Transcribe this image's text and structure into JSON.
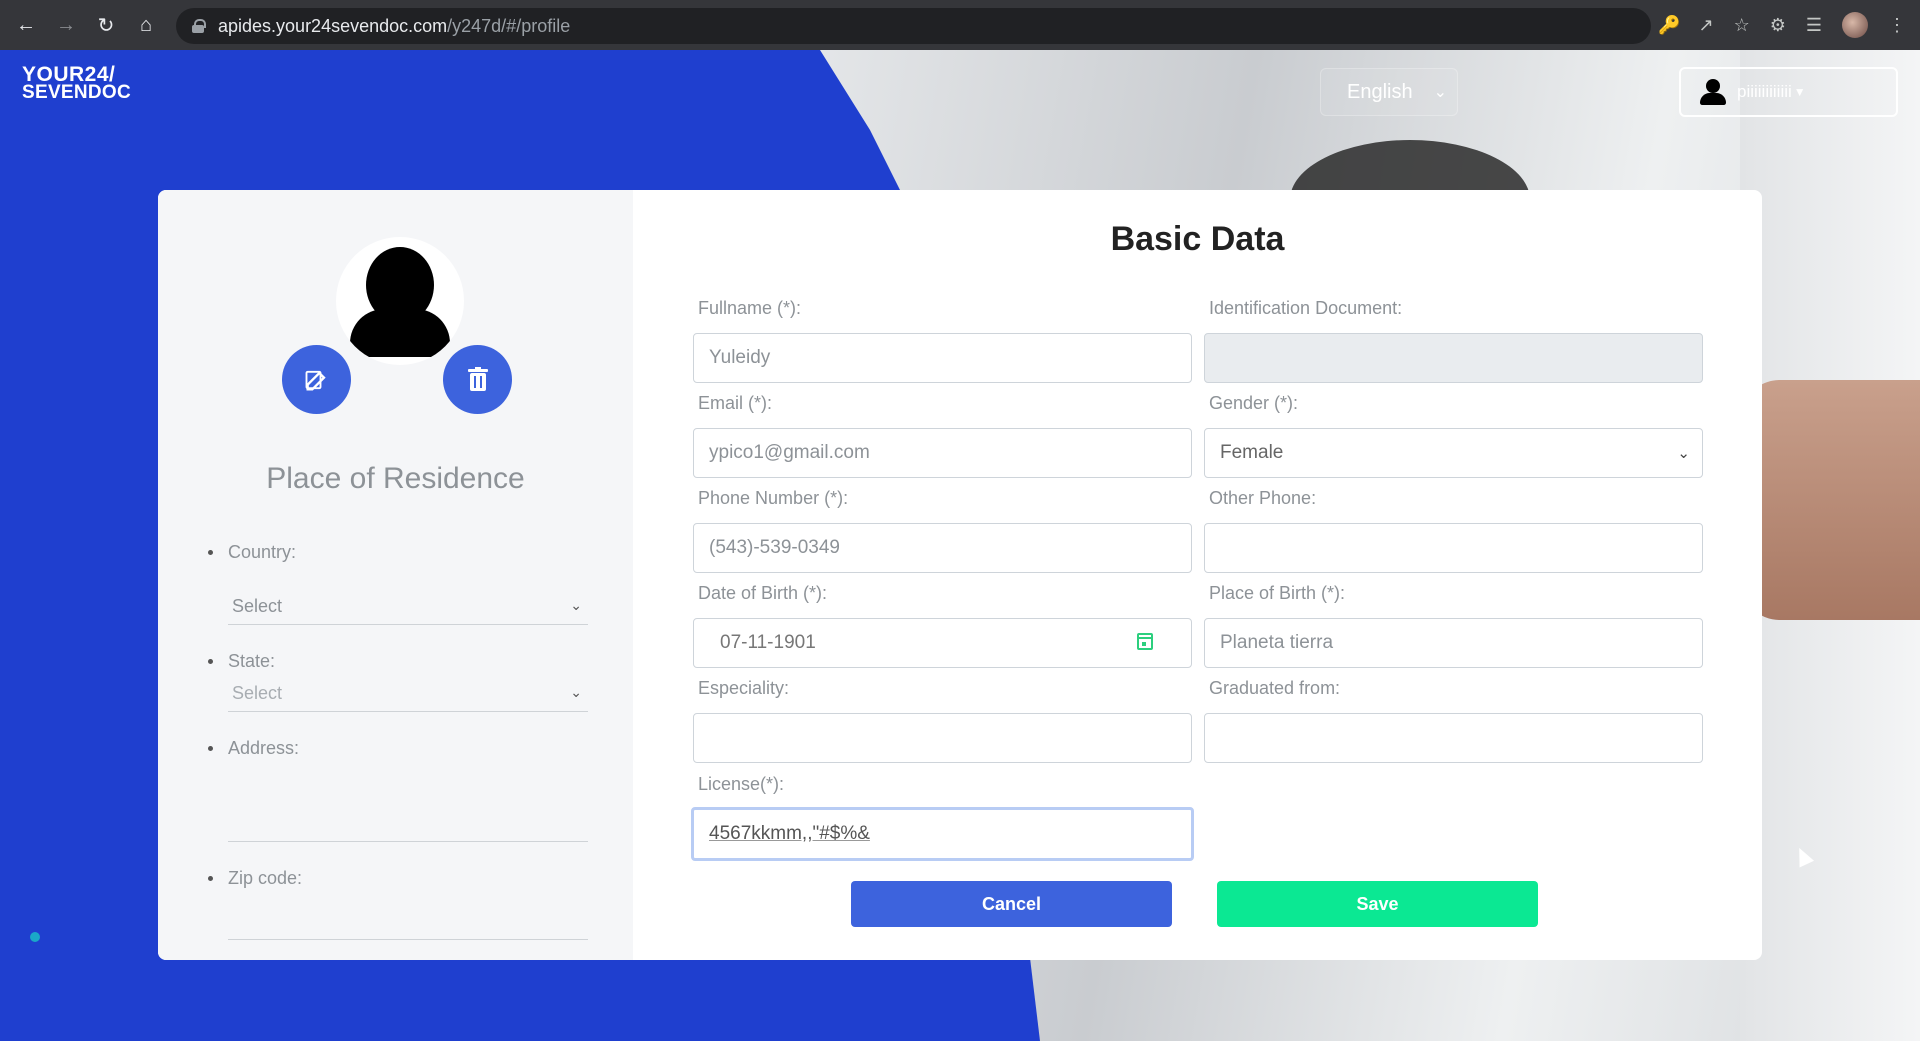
{
  "browser": {
    "url_host": "apides.your24sevendoc.com",
    "url_path": "/y247d/#/profile"
  },
  "header": {
    "logo_line1": "YOUR24/",
    "logo_line2": "SEVENDOC",
    "language": "English",
    "username": "piiiiiiiiiiii"
  },
  "sidebar": {
    "residence_title": "Place of Residence",
    "country_label": "Country:",
    "country_value": "Select",
    "state_label": "State:",
    "state_value": "Select",
    "address_label": "Address:",
    "zip_label": "Zip code:"
  },
  "form": {
    "title": "Basic Data",
    "fullname_label": "Fullname (*):",
    "fullname_value": "Yuleidy",
    "id_doc_label": "Identification Document:",
    "id_doc_value": "",
    "email_label": "Email (*):",
    "email_value": "ypico1@gmail.com",
    "gender_label": "Gender (*):",
    "gender_value": "Female",
    "phone_label": "Phone Number (*):",
    "phone_value": "(543)-539-0349",
    "other_phone_label": "Other Phone:",
    "other_phone_value": "",
    "dob_label": "Date of Birth (*):",
    "dob_value": "07-11-1901",
    "pob_label": "Place of Birth (*):",
    "pob_value": "Planeta tierra",
    "speciality_label": "Especiality:",
    "speciality_value": "",
    "graduated_label": "Graduated from:",
    "graduated_value": "",
    "license_label": "License(*):",
    "license_value": "4567kkmm,,\"#$%&",
    "cancel_label": "Cancel",
    "save_label": "Save"
  },
  "colors": {
    "brand_blue": "#1f3fcf",
    "button_blue": "#3d63dd",
    "save_green": "#0be893"
  }
}
